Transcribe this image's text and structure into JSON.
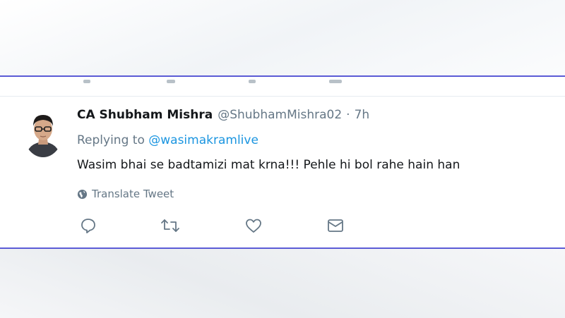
{
  "tweet": {
    "author_name": "CA Shubham Mishra",
    "handle": "@ShubhamMishra02",
    "separator": "·",
    "time": "7h",
    "replying_prefix": "Replying to",
    "replying_to": "@wasimakramlive",
    "text": "Wasim bhai se badtamizi mat krna!!! Pehle hi bol rahe hain han",
    "translate_label": "Translate Tweet"
  },
  "icons": {
    "reply": "comment-bubble-icon",
    "retweet": "retweet-icon",
    "like": "heart-icon",
    "dm": "envelope-icon",
    "translate": "globe-icon"
  },
  "colors": {
    "card_border": "#5b5bd6",
    "link": "#1b95e0",
    "secondary_text": "#657786",
    "primary_text": "#14171a"
  }
}
